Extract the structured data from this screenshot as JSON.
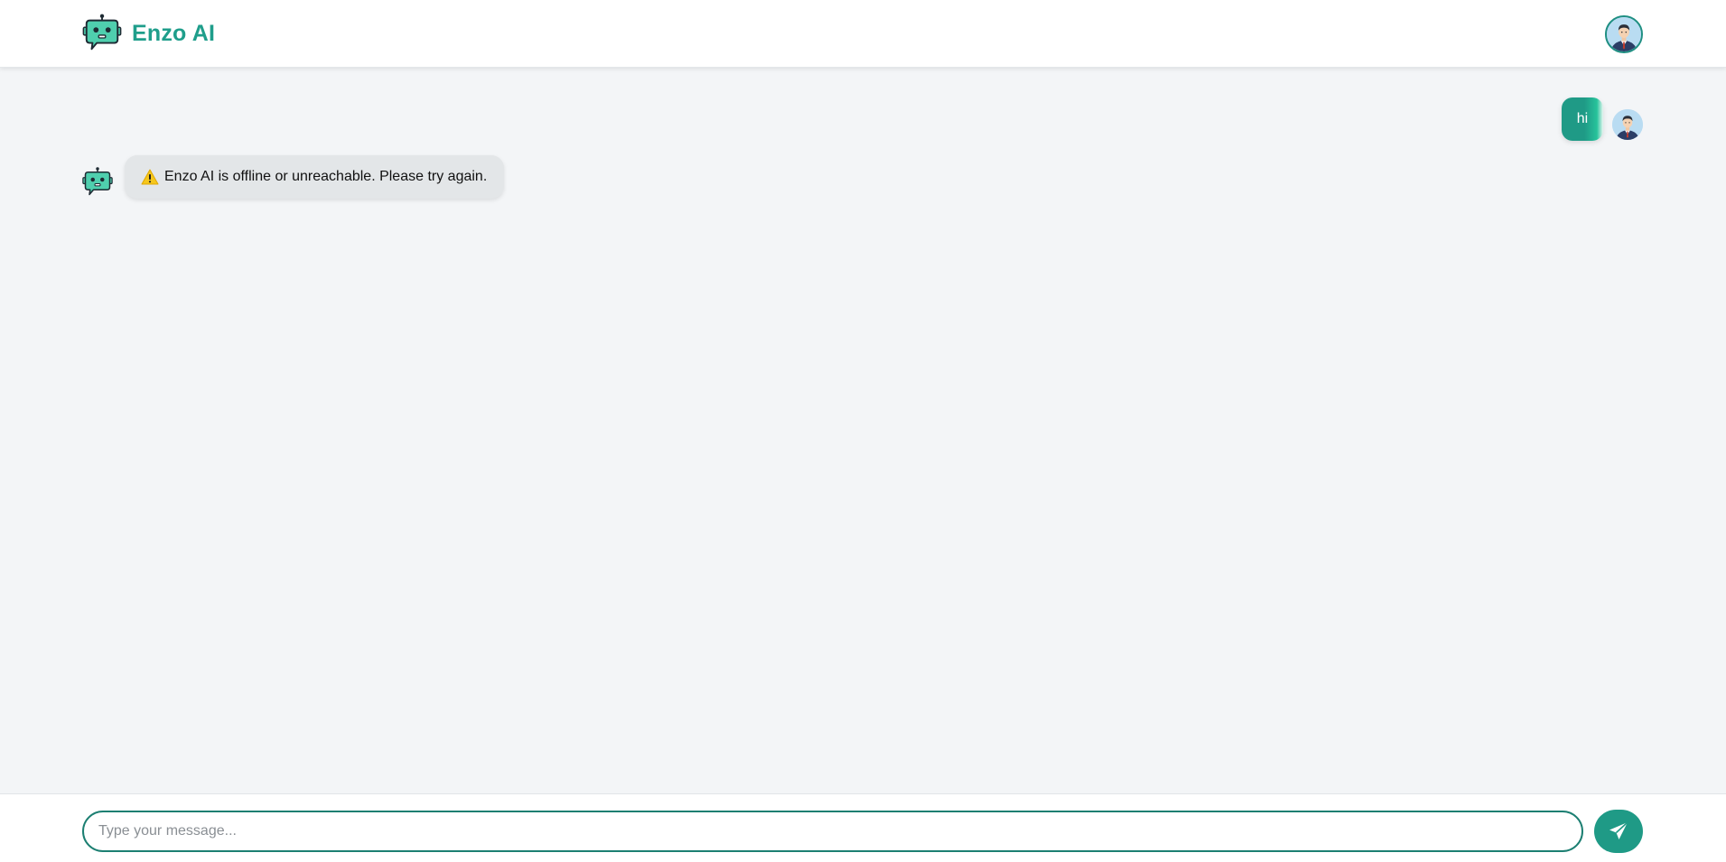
{
  "app": {
    "name": "Enzo AI",
    "brand_icon": "robot-icon",
    "profile_icon": "user-avatar-icon"
  },
  "colors": {
    "accent": "#1f9e8b",
    "user_bubble": "#1f9a86",
    "bot_bubble": "#e3e6e8",
    "background": "#f3f5f7",
    "input_border": "#1c7f72"
  },
  "messages": [
    {
      "sender": "user",
      "text": "hi"
    },
    {
      "sender": "bot",
      "icon": "warning-icon",
      "text": "Enzo AI is offline or unreachable. Please try again."
    }
  ],
  "composer": {
    "placeholder": "Type your message...",
    "value": "",
    "send_icon": "send-icon"
  }
}
